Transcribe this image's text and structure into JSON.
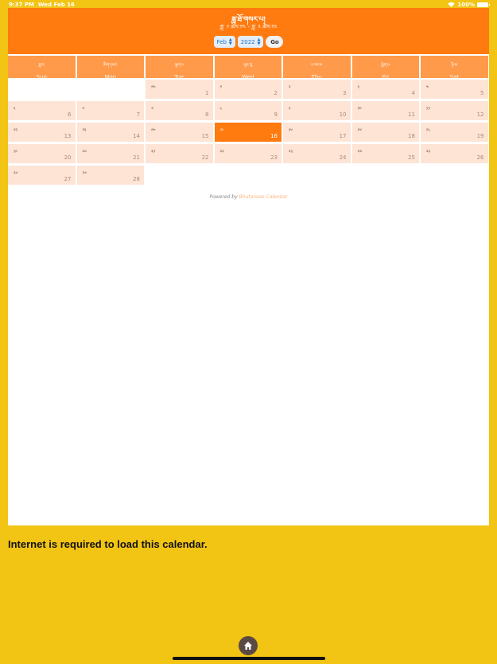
{
  "status_bar": {
    "time": "9:37 PM",
    "date": "Wed Feb 16",
    "battery": "100%"
  },
  "header": {
    "title": "ཟླ་ཐོ་གསར་པ།",
    "subtitle": "ཟླ་ ༡ ཚེས་༡༤ - ཟླ་ ༢ ཚེས་༡༢",
    "month_select": "Feb",
    "year_select": "2022",
    "go_label": "Go"
  },
  "weekdays": [
    {
      "bt": "ཟླ་བ",
      "en": "Sun"
    },
    {
      "bt": "མིག་དམར",
      "en": "Mon"
    },
    {
      "bt": "ལྷག་པ",
      "en": "Tue"
    },
    {
      "bt": "ཕུར་བུ",
      "en": "Wed"
    },
    {
      "bt": "པ་སངས",
      "en": "Thu"
    },
    {
      "bt": "སྤེན་པ",
      "en": "Fri"
    },
    {
      "bt": "ཉི་མ",
      "en": "Sat"
    }
  ],
  "days": [
    {
      "day": "1",
      "bt": "༡༤"
    },
    {
      "day": "2",
      "bt": "༡"
    },
    {
      "day": "3",
      "bt": "༢"
    },
    {
      "day": "4",
      "bt": "༣"
    },
    {
      "day": "5",
      "bt": "༤"
    },
    {
      "day": "6",
      "bt": "༥"
    },
    {
      "day": "7",
      "bt": "༦"
    },
    {
      "day": "8",
      "bt": "༧"
    },
    {
      "day": "9",
      "bt": "༨"
    },
    {
      "day": "10",
      "bt": "༩"
    },
    {
      "day": "11",
      "bt": "༡༠"
    },
    {
      "day": "12",
      "bt": "༡༡"
    },
    {
      "day": "13",
      "bt": "༡༢"
    },
    {
      "day": "14",
      "bt": "༡༣"
    },
    {
      "day": "15",
      "bt": "༡༤"
    },
    {
      "day": "16",
      "bt": "༡༥",
      "today": true
    },
    {
      "day": "17",
      "bt": "༡༦"
    },
    {
      "day": "18",
      "bt": "༡༧"
    },
    {
      "day": "19",
      "bt": "༡༨"
    },
    {
      "day": "20",
      "bt": "༡༩"
    },
    {
      "day": "21",
      "bt": "༢༠"
    },
    {
      "day": "22",
      "bt": "༢༡"
    },
    {
      "day": "23",
      "bt": "༢༢"
    },
    {
      "day": "24",
      "bt": "༢༣"
    },
    {
      "day": "25",
      "bt": "༢༤"
    },
    {
      "day": "26",
      "bt": "༢༥"
    },
    {
      "day": "27",
      "bt": "༢༦"
    },
    {
      "day": "28",
      "bt": "༢༧"
    }
  ],
  "first_weekday": 2,
  "powered": {
    "prefix": "Powered by ",
    "link": "Bhutanese Calendar"
  },
  "notice": "Internet is required to load this calendar.",
  "colors": {
    "header": "#ff7a0f",
    "weekday": "#ff9a4a",
    "cell": "#fde4d5",
    "page_bg": "#f2c414"
  }
}
